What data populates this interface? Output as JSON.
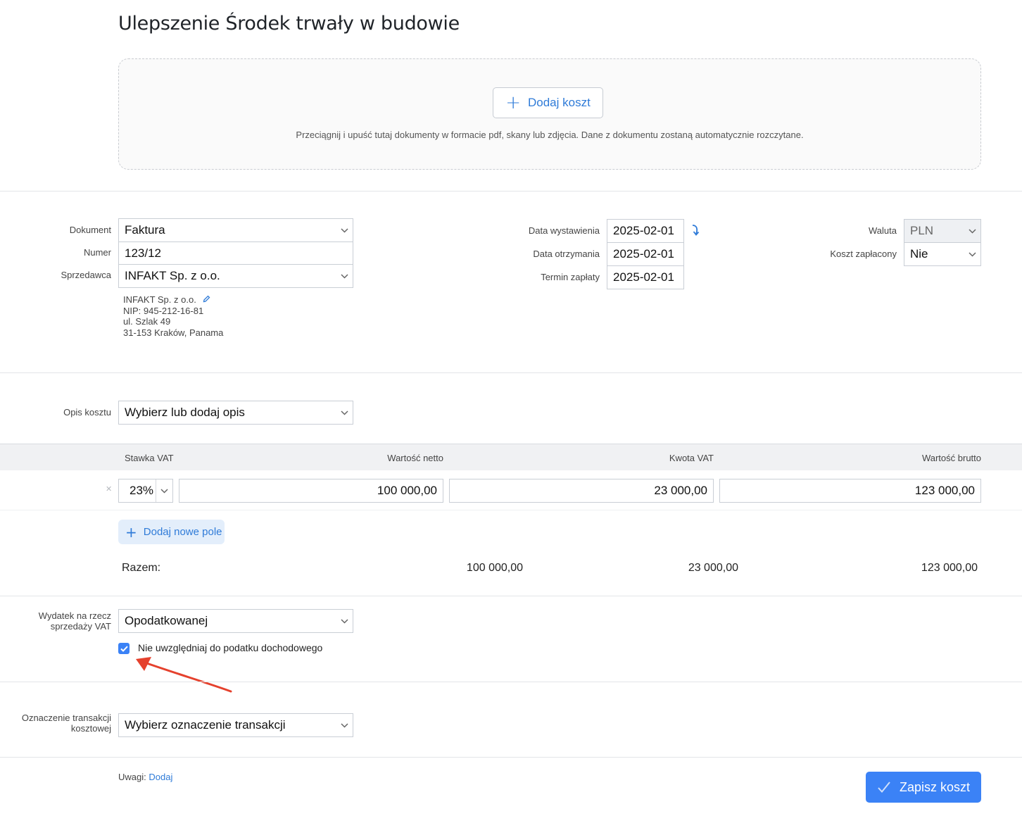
{
  "page": {
    "title": "Ulepszenie Środek trwały w budowie"
  },
  "dropzone": {
    "add_button": "Dodaj koszt",
    "hint": "Przeciągnij i upuść tutaj dokumenty w formacie pdf, skany lub zdjęcia. Dane z dokumentu zostaną automatycznie rozczytane."
  },
  "document": {
    "dokument_label": "Dokument",
    "dokument_value": "Faktura",
    "numer_label": "Numer",
    "numer_value": "123/12",
    "sprzedawca_label": "Sprzedawca",
    "sprzedawca_value": "INFAKT Sp. z o.o.",
    "seller_info": {
      "name": "INFAKT Sp. z o.o.",
      "nip": "NIP: 945-212-16-81",
      "street": "ul. Szlak 49",
      "city": "31-153 Kraków, Panama"
    }
  },
  "dates": {
    "issue_label": "Data wystawienia",
    "issue_value": "2025-02-01",
    "received_label": "Data otrzymania",
    "received_value": "2025-02-01",
    "due_label": "Termin zapłaty",
    "due_value": "2025-02-01"
  },
  "payment": {
    "currency_label": "Waluta",
    "currency_value": "PLN",
    "paid_label": "Koszt zapłacony",
    "paid_value": "Nie"
  },
  "description": {
    "label": "Opis kosztu",
    "value": "Wybierz lub dodaj opis"
  },
  "vat_table": {
    "headers": {
      "rate": "Stawka VAT",
      "net": "Wartość netto",
      "vat": "Kwota VAT",
      "gross": "Wartość brutto"
    },
    "rows": [
      {
        "rate": "23%",
        "net": "100 000,00",
        "vat": "23 000,00",
        "gross": "123 000,00"
      }
    ],
    "add_field": "Dodaj nowe pole",
    "total_label": "Razem:",
    "total_net": "100 000,00",
    "total_vat": "23 000,00",
    "total_gross": "123 000,00"
  },
  "vat_sale": {
    "label_line1": "Wydatek na rzecz",
    "label_line2": "sprzedaży VAT",
    "value": "Opodatkowanej",
    "checkbox_label": "Nie uwzględniaj do podatku dochodowego",
    "checkbox_checked": true
  },
  "transaction": {
    "label_line1": "Oznaczenie transakcji",
    "label_line2": "kosztowej",
    "value": "Wybierz oznaczenie transakcji"
  },
  "footer": {
    "notes_label": "Uwagi:",
    "notes_link": "Dodaj",
    "save_button": "Zapisz koszt"
  },
  "colors": {
    "accent": "#3b82f6",
    "link": "#2f7bd8",
    "annotation_arrow": "#e5412d"
  }
}
